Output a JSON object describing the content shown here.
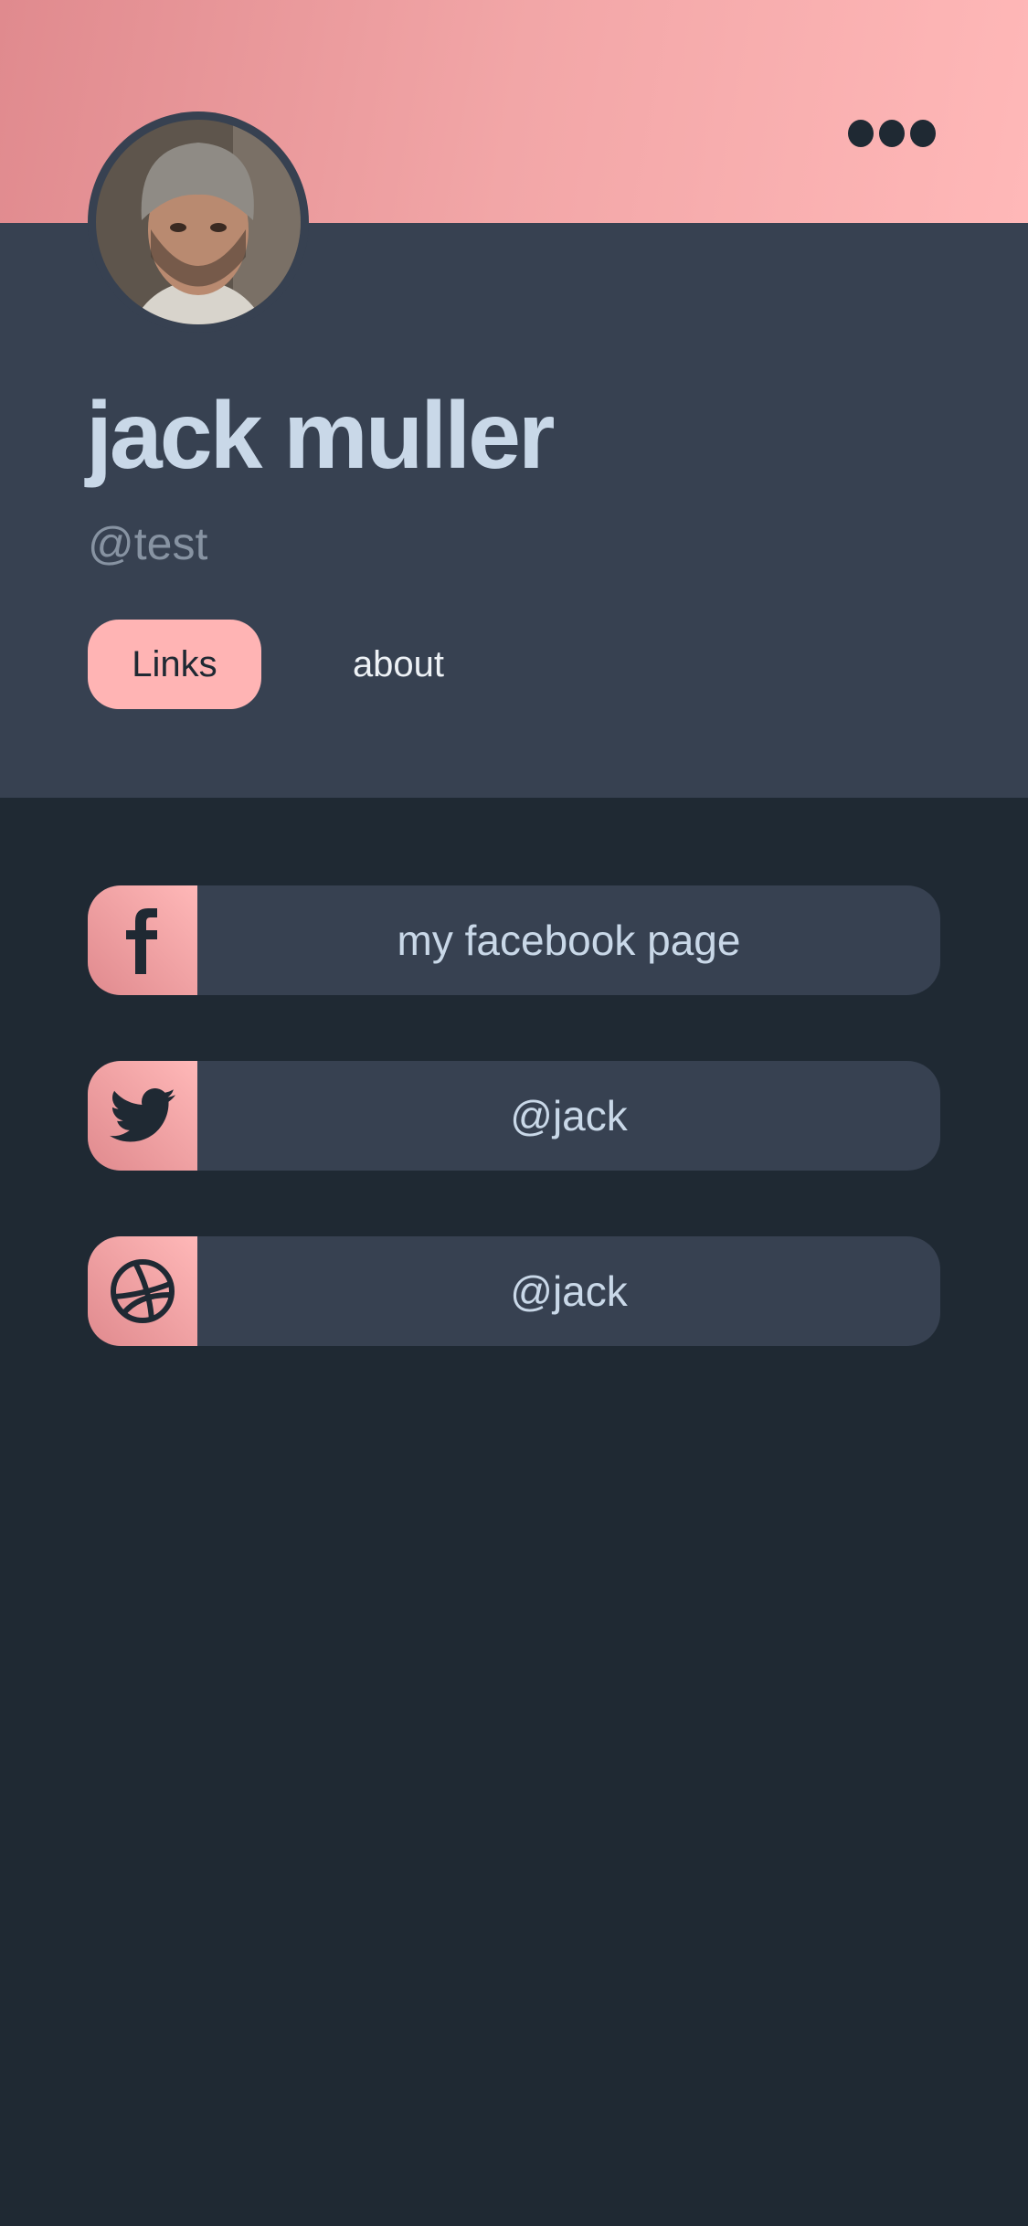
{
  "header": {
    "menu_icon": "more-horizontal-icon"
  },
  "profile": {
    "name": "jack muller",
    "handle": "@test",
    "tabs": [
      {
        "label": "Links",
        "active": true
      },
      {
        "label": "about",
        "active": false
      }
    ]
  },
  "links": [
    {
      "icon": "facebook-icon",
      "label": "my facebook page"
    },
    {
      "icon": "twitter-icon",
      "label": "@jack"
    },
    {
      "icon": "dribbble-icon",
      "label": "@jack"
    }
  ],
  "colors": {
    "accent": "#ffb4b4",
    "panel": "#374151",
    "background": "#1f2933",
    "name": "#c9d8e8"
  }
}
